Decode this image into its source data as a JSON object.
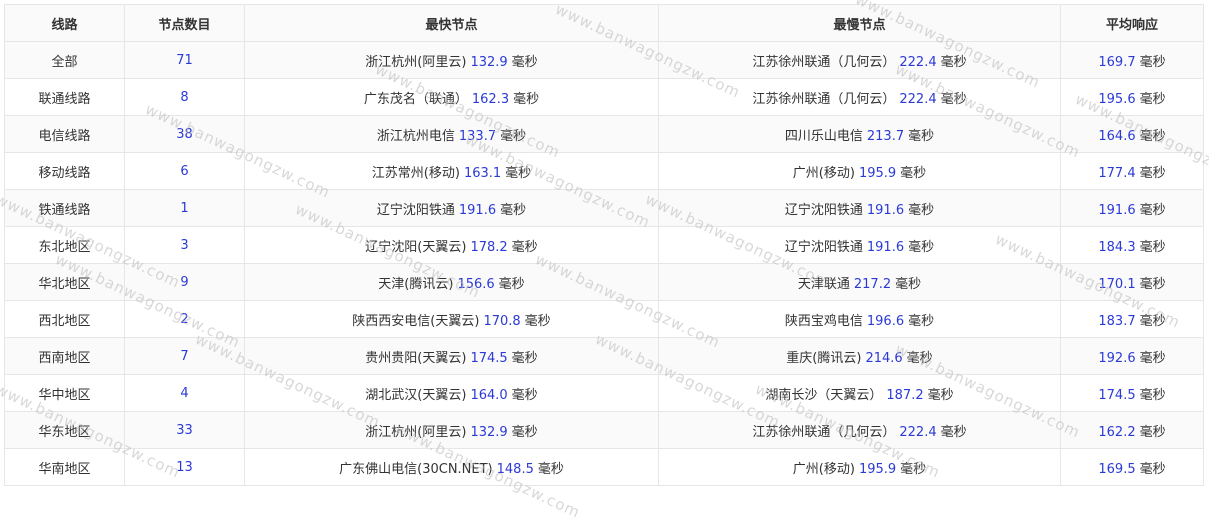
{
  "headers": {
    "route": "线路",
    "count": "节点数目",
    "fastest": "最快节点",
    "slowest": "最慢节点",
    "avg": "平均响应"
  },
  "unit": "毫秒",
  "watermark": "www.banwagongzw.com",
  "colors": {
    "number": "#2b3ad6",
    "border": "#e6e6e6",
    "stripe": "#fafafa"
  },
  "rows": [
    {
      "route": "全部",
      "count": "71",
      "fast_name": "浙江杭州(阿里云)",
      "fast_ms": "132.9",
      "slow_name": "江苏徐州联通（几何云）",
      "slow_ms": "222.4",
      "avg_ms": "169.7"
    },
    {
      "route": "联通线路",
      "count": "8",
      "fast_name": "广东茂名（联通）",
      "fast_ms": "162.3",
      "slow_name": "江苏徐州联通（几何云）",
      "slow_ms": "222.4",
      "avg_ms": "195.6"
    },
    {
      "route": "电信线路",
      "count": "38",
      "fast_name": "浙江杭州电信",
      "fast_ms": "133.7",
      "slow_name": "四川乐山电信",
      "slow_ms": "213.7",
      "avg_ms": "164.6"
    },
    {
      "route": "移动线路",
      "count": "6",
      "fast_name": "江苏常州(移动)",
      "fast_ms": "163.1",
      "slow_name": "广州(移动)",
      "slow_ms": "195.9",
      "avg_ms": "177.4"
    },
    {
      "route": "铁通线路",
      "count": "1",
      "fast_name": "辽宁沈阳铁通",
      "fast_ms": "191.6",
      "slow_name": "辽宁沈阳铁通",
      "slow_ms": "191.6",
      "avg_ms": "191.6"
    },
    {
      "route": "东北地区",
      "count": "3",
      "fast_name": "辽宁沈阳(天翼云)",
      "fast_ms": "178.2",
      "slow_name": "辽宁沈阳铁通",
      "slow_ms": "191.6",
      "avg_ms": "184.3"
    },
    {
      "route": "华北地区",
      "count": "9",
      "fast_name": "天津(腾讯云)",
      "fast_ms": "156.6",
      "slow_name": "天津联通",
      "slow_ms": "217.2",
      "avg_ms": "170.1"
    },
    {
      "route": "西北地区",
      "count": "2",
      "fast_name": "陕西西安电信(天翼云)",
      "fast_ms": "170.8",
      "slow_name": "陕西宝鸡电信",
      "slow_ms": "196.6",
      "avg_ms": "183.7"
    },
    {
      "route": "西南地区",
      "count": "7",
      "fast_name": "贵州贵阳(天翼云)",
      "fast_ms": "174.5",
      "slow_name": "重庆(腾讯云)",
      "slow_ms": "214.6",
      "avg_ms": "192.6"
    },
    {
      "route": "华中地区",
      "count": "4",
      "fast_name": "湖北武汉(天翼云)",
      "fast_ms": "164.0",
      "slow_name": "湖南长沙（天翼云）",
      "slow_ms": "187.2",
      "avg_ms": "174.5"
    },
    {
      "route": "华东地区",
      "count": "33",
      "fast_name": "浙江杭州(阿里云)",
      "fast_ms": "132.9",
      "slow_name": "江苏徐州联通（几何云）",
      "slow_ms": "222.4",
      "avg_ms": "162.2"
    },
    {
      "route": "华南地区",
      "count": "13",
      "fast_name": "广东佛山电信(30CN.NET)",
      "fast_ms": "148.5",
      "slow_name": "广州(移动)",
      "slow_ms": "195.9",
      "avg_ms": "169.5"
    }
  ]
}
